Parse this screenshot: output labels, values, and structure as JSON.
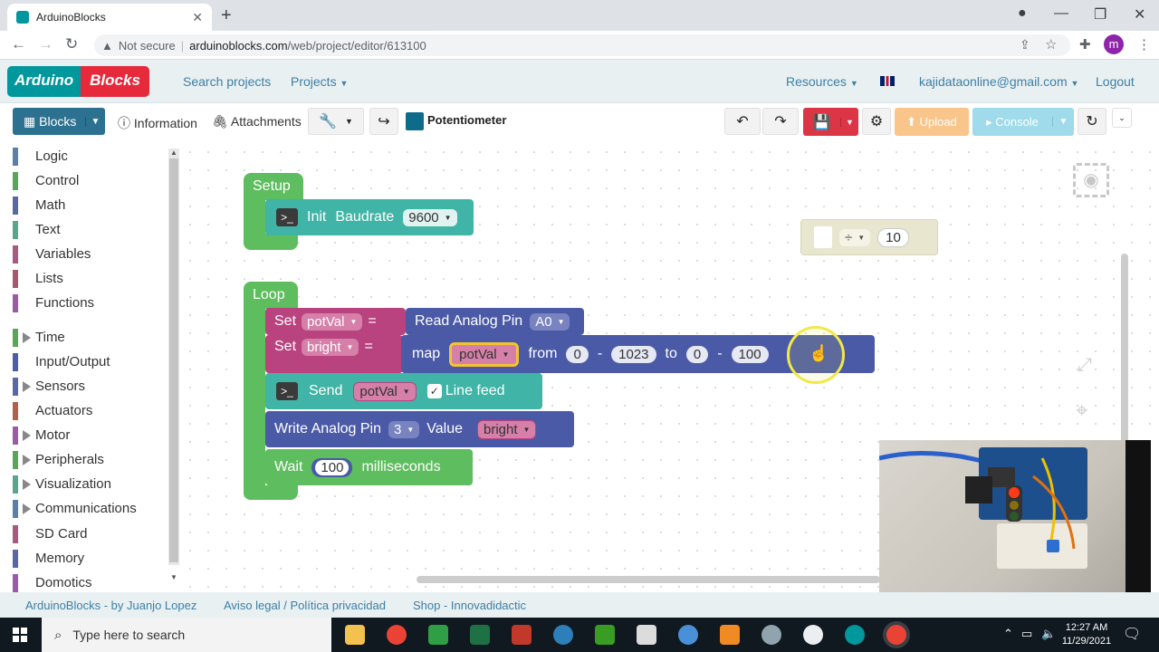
{
  "browser": {
    "tab_title": "ArduinoBlocks",
    "new_tab": "+",
    "security": "Not secure",
    "url_domain": "arduinoblocks.com",
    "url_path": "/web/project/editor/613100",
    "profile_initial": "m"
  },
  "header": {
    "logo_part1": "Arduino",
    "logo_part2": "Blocks",
    "search_projects": "Search projects",
    "projects": "Projects",
    "resources": "Resources",
    "user_email": "kajidataonline@gmail.com",
    "logout": "Logout"
  },
  "toolbar": {
    "blocks": "Blocks",
    "information": "Information",
    "attachments": "Attachments",
    "project_name": "Potentiometer",
    "upload": "Upload",
    "console": "Console"
  },
  "sidebar": {
    "categories": [
      {
        "label": "Logic",
        "color": "#5b80a5",
        "expandable": false
      },
      {
        "label": "Control",
        "color": "#5ba55b",
        "expandable": false
      },
      {
        "label": "Math",
        "color": "#5b67a5",
        "expandable": false
      },
      {
        "label": "Text",
        "color": "#5ba58c",
        "expandable": false
      },
      {
        "label": "Variables",
        "color": "#a55b80",
        "expandable": false
      },
      {
        "label": "Lists",
        "color": "#a5586e",
        "expandable": false
      },
      {
        "label": "Functions",
        "color": "#995ba5",
        "expandable": false
      },
      {
        "label": "Time",
        "color": "#5ba55b",
        "expandable": true
      },
      {
        "label": "Input/Output",
        "color": "#4c5ea8",
        "expandable": false
      },
      {
        "label": "Sensors",
        "color": "#5b67a5",
        "expandable": true
      },
      {
        "label": "Actuators",
        "color": "#b0604a",
        "expandable": false
      },
      {
        "label": "Motor",
        "color": "#995ba5",
        "expandable": true
      },
      {
        "label": "Peripherals",
        "color": "#5ba55b",
        "expandable": true
      },
      {
        "label": "Visualization",
        "color": "#5ba58c",
        "expandable": true
      },
      {
        "label": "Communications",
        "color": "#5b80a5",
        "expandable": true
      },
      {
        "label": "SD Card",
        "color": "#a55b80",
        "expandable": false
      },
      {
        "label": "Memory",
        "color": "#5b67a5",
        "expandable": false
      },
      {
        "label": "Domotics",
        "color": "#995ba5",
        "expandable": false
      }
    ]
  },
  "workspace": {
    "setup_label": "Setup",
    "init_label": "Init",
    "baudrate_label": "Baudrate",
    "baudrate_value": "9600",
    "divide_op": "÷",
    "divide_value": "10",
    "loop_label": "Loop",
    "set1_label": "Set",
    "set1_var": "potVal",
    "equals": "=",
    "read_analog_label": "Read Analog Pin",
    "read_analog_pin": "A0",
    "set2_label": "Set",
    "set2_var": "bright",
    "map_label": "map",
    "map_var": "potVal",
    "from_label": "from",
    "from_low": "0",
    "dash": "-",
    "from_high": "1023",
    "to_label": "to",
    "to_low": "0",
    "to_high": "100",
    "send_label": "Send",
    "send_var": "potVal",
    "line_feed_label": "Line feed",
    "write_analog_label": "Write Analog Pin",
    "write_pin": "3",
    "value_label": "Value",
    "write_var": "bright",
    "wait_label": "Wait",
    "wait_value": "100",
    "milliseconds_label": "milliseconds"
  },
  "footer": {
    "credit": "ArduinoBlocks - by Juanjo Lopez",
    "legal": "Aviso legal / Política privacidad",
    "shop": "Shop - Innovadidactic"
  },
  "taskbar": {
    "search_placeholder": "Type here to search",
    "time": "12:27 AM",
    "date": "11/29/2021"
  }
}
